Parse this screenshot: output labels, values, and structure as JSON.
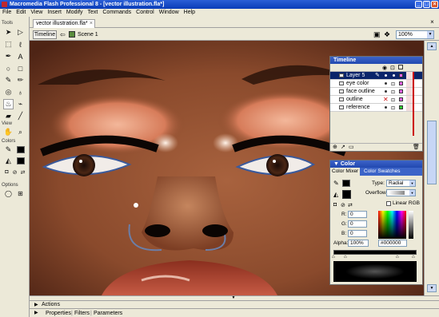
{
  "window": {
    "title": "Macromedia Flash Professional 8 - [vector illustration.fla*]",
    "minimize": "_",
    "maximize": "□",
    "close": "×"
  },
  "menu": [
    "File",
    "Edit",
    "View",
    "Insert",
    "Modify",
    "Text",
    "Commands",
    "Control",
    "Window",
    "Help"
  ],
  "tools_panel": {
    "tools_header": "Tools",
    "view_header": "View",
    "colors_header": "Colors",
    "options_header": "Options",
    "tool_icons": [
      "arrow-icon",
      "subselect-icon",
      "line-icon",
      "lasso-icon",
      "pen-icon",
      "text-icon",
      "oval-icon",
      "rectangle-icon",
      "pencil-icon",
      "brush-icon",
      "free-transform-icon",
      "fill-transform-icon",
      "ink-bottle-icon",
      "paint-bucket-icon",
      "eyedropper-icon",
      "eraser-icon"
    ],
    "active_tool": "paint-bucket-icon"
  },
  "document": {
    "tab_label": "vector illustration.fla*",
    "timeline_button": "Timeline",
    "scene_label": "Scene 1",
    "zoom": "100%"
  },
  "timeline": {
    "title": "Timeline",
    "layers": [
      {
        "name": "Layer 5",
        "selected": true,
        "color": "#ff66ff"
      },
      {
        "name": "eye color",
        "selected": false,
        "color": "#ff66ff"
      },
      {
        "name": "face outline",
        "selected": false,
        "color": "#ff66ff"
      },
      {
        "name": "outline",
        "selected": false,
        "color": "#ff66ff"
      },
      {
        "name": "reference",
        "selected": false,
        "color": "#33cc33"
      }
    ]
  },
  "color_panel": {
    "title": "Color",
    "tab_mixer": "Color Mixer",
    "tab_swatches": "Color Swatches",
    "type_label": "Type:",
    "type_value": "Radial",
    "overflow_label": "Overflow:",
    "linear_rgb_label": "Linear RGB",
    "r_label": "R:",
    "r_value": "0",
    "g_label": "G:",
    "g_value": "0",
    "b_label": "B:",
    "b_value": "0",
    "alpha_label": "Alpha:",
    "alpha_value": "100%",
    "hex_value": "#000000"
  },
  "bottom": {
    "actions_label": "Actions",
    "properties_label": "Properties",
    "filters_label": "Filters",
    "parameters_label": "Parameters"
  }
}
